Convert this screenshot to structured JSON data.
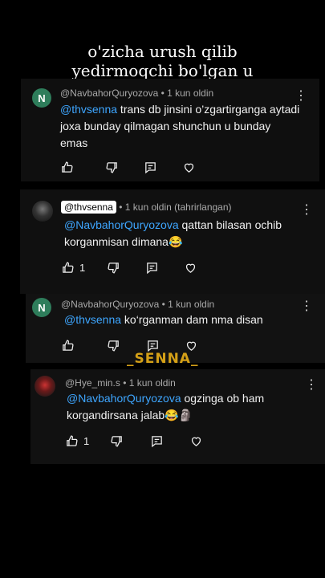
{
  "caption": {
    "line1": "o'zicha urush qilib",
    "line2": "yedirmoqchi bo'lgan u"
  },
  "watermark": "_SENNA_",
  "comments": [
    {
      "avatar_letter": "N",
      "username": "@NavbahorQuryozova",
      "time": "1 kun oldin",
      "edited": "",
      "mention": "@thvsenna",
      "text": " trans db jinsini o’zgartirganga aytadi joxa bunday qilmagan shunchun u bunday emas",
      "likes": ""
    },
    {
      "avatar_letter": "",
      "username": "@thvsenna",
      "time": "1 kun oldin (tahrirlangan)",
      "mention": "@NavbahorQuryozova",
      "text": "  qattan bilasan ochib korganmisan dimana😂",
      "likes": "1"
    },
    {
      "avatar_letter": "N",
      "username": "@NavbahorQuryozova",
      "time": "1 kun oldin",
      "mention": "@thvsenna",
      "text": " ko‘rganman dam nma disan",
      "likes": ""
    },
    {
      "avatar_letter": "",
      "username": "@Hye_min.s",
      "time": "1 kun oldin",
      "mention": "@NavbahorQuryozova",
      "text": "  ogzinga ob ham korgandirsana jalab😂🗿",
      "likes": "1"
    }
  ],
  "icons": {
    "like": "thumbs-up-icon",
    "dislike": "thumbs-down-icon",
    "reply": "reply-icon",
    "heart": "heart-icon",
    "menu": "more-vert-icon"
  }
}
